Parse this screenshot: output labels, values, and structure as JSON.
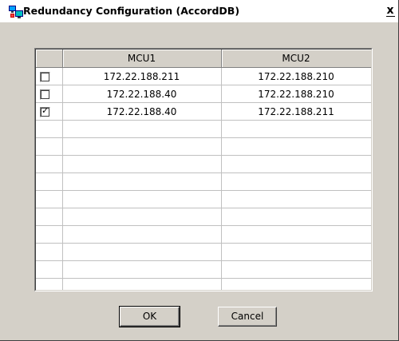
{
  "window": {
    "title": "Redundancy Configuration (AccordDB)",
    "close_label": "x"
  },
  "grid": {
    "columns": [
      "",
      "MCU1",
      "MCU2"
    ],
    "rows": [
      {
        "checked": false,
        "mcu1": "172.22.188.211",
        "mcu2": "172.22.188.210"
      },
      {
        "checked": false,
        "mcu1": "172.22.188.40",
        "mcu2": "172.22.188.210"
      },
      {
        "checked": true,
        "mcu1": "172.22.188.40",
        "mcu2": "172.22.188.211"
      }
    ],
    "empty_row_count": 11
  },
  "buttons": {
    "ok_label": "OK",
    "cancel_label": "Cancel"
  },
  "icons": {
    "app": "network-computers-icon",
    "check": "check-mark-icon"
  }
}
